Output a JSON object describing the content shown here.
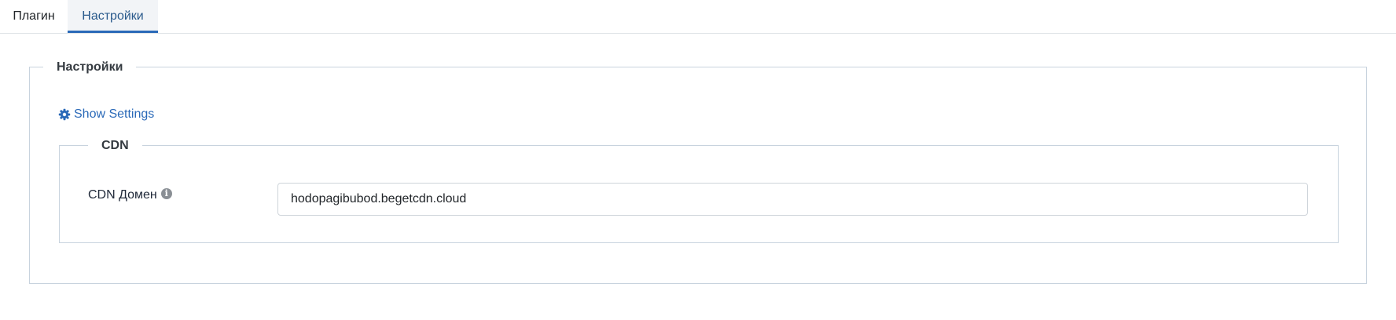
{
  "tabs": [
    {
      "label": "Плагин",
      "active": false
    },
    {
      "label": "Настройки",
      "active": true
    }
  ],
  "settings_fieldset": {
    "legend": "Настройки",
    "show_settings_label": "Show Settings",
    "show_settings_icon": "gear-icon"
  },
  "cdn_fieldset": {
    "legend": "CDN",
    "field": {
      "label": "CDN Домен",
      "info_icon": "info-icon",
      "value": "hodopagibubod.begetcdn.cloud"
    }
  },
  "colors": {
    "accent": "#2a69b8",
    "active_tab_bg": "#f2f4f7",
    "border": "#c8d3de"
  }
}
